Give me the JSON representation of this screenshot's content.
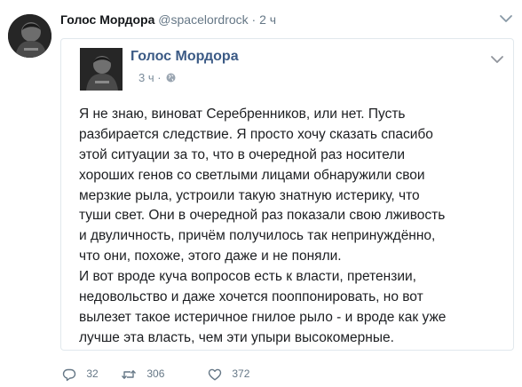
{
  "tweet": {
    "author_name": "Голос Мордора",
    "handle": "@spacelordrock",
    "separator": "·",
    "time": "2 ч",
    "icons": {
      "avatar": "avatar-photo",
      "menu": "chevron-down-icon"
    }
  },
  "embed": {
    "page_name": "Голос Мордора",
    "time": "3 ч",
    "separator": "·",
    "icons": {
      "privacy": "globe-icon",
      "menu": "chevron-down-icon"
    },
    "lines": [
      "Я не знаю, виноват Серебренников, или нет. Пусть",
      "разбирается следствие. Я просто хочу сказать спасибо",
      "этой ситуации за то, что в очередной раз носители",
      "хороших генов со светлыми лицами обнаружили свои",
      "мерзкие рыла, устроили такую знатную истерику, что",
      "туши свет. Они в очередной раз показали свою лживость",
      "и двуличность, причём получилось так непринуждённо,",
      "что они, похоже, этого даже и не поняли.",
      "И вот вроде куча вопросов есть к власти, претензии,",
      "недовольство и даже хочется пооппонировать, но вот",
      "вылезет такое истеричное гнилое рыло - и вроде как уже",
      "лучше эта власть, чем эти упыри высокомерные."
    ]
  },
  "actions": {
    "reply_count": "32",
    "retweet_count": "306",
    "like_count": "372",
    "icons": [
      "reply-icon",
      "retweet-icon",
      "like-icon"
    ]
  },
  "colors": {
    "text": "#14171a",
    "muted": "#657786",
    "facebook_name": "#3b5a85",
    "border": "#e1e8ed"
  }
}
